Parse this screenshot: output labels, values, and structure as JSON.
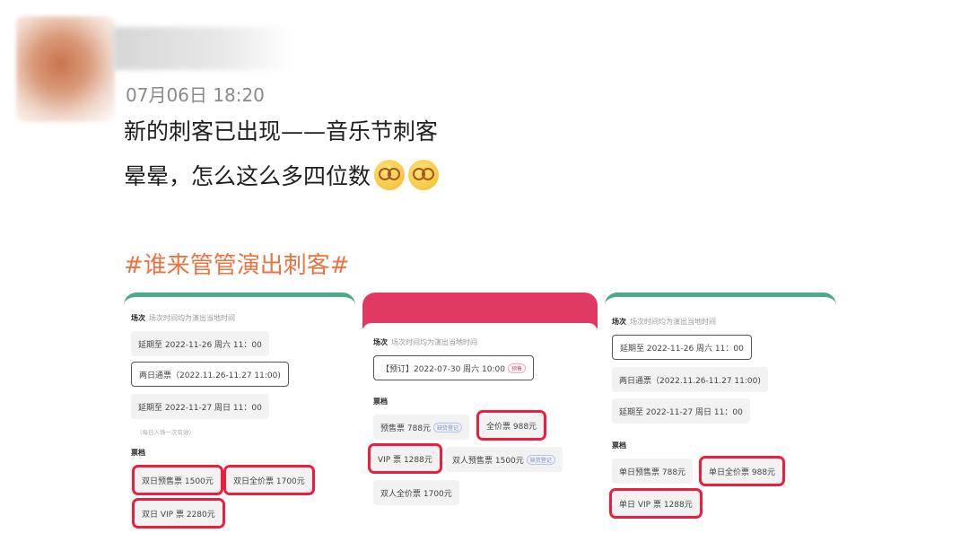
{
  "post": {
    "time": "07月06日 18:20",
    "line1": "新的刺客已出现——音乐节刺客",
    "line2": "晕晕，怎么这么多四位数",
    "hashtag": "#谁来管管演出刺客#"
  },
  "shot1": {
    "session_label": "场次",
    "session_sub": "场次时间均为演出当地时间",
    "sessions": [
      "延期至 2022-11-26 周六 11：00",
      "两日通票（2022.11.26-11.27 11:00)",
      "延期至 2022-11-27 周日 11：00"
    ],
    "session_note": "（每日入场一次有效）",
    "tier_label": "票档",
    "tiers": [
      "双日预售票 1500元",
      "双日全价票 1700元",
      "双日 VIP 票 2280元"
    ]
  },
  "shot2": {
    "session_label": "场次",
    "session_sub": "场次时间均为演出当地时间",
    "session": "【预订】2022-07-30 周六 10:00",
    "session_tag": "预售",
    "tier_label": "票档",
    "tiers": [
      "预售票 788元",
      "全价票 988元",
      "VIP 票 1288元",
      "双人预售票 1500元",
      "双人全价票 1700元"
    ],
    "tier_tag": "缺货登记"
  },
  "shot3": {
    "session_label": "场次",
    "session_sub": "场次时间均为演出当地时间",
    "sessions": [
      "延期至 2022-11-26 周六 11：00",
      "两日通票（2022.11.26-11.27 11:00)",
      "延期至 2022-11-27 周日 11：00"
    ],
    "tier_label": "票档",
    "tiers": [
      "单日预售票 788元",
      "单日全价票 988元",
      "单日 VIP 票 1288元"
    ]
  },
  "colors": {
    "accent": "#eb7340",
    "highlight": "#ee1d3d",
    "green": "#4aaa8c",
    "pink": "#e03a63"
  }
}
